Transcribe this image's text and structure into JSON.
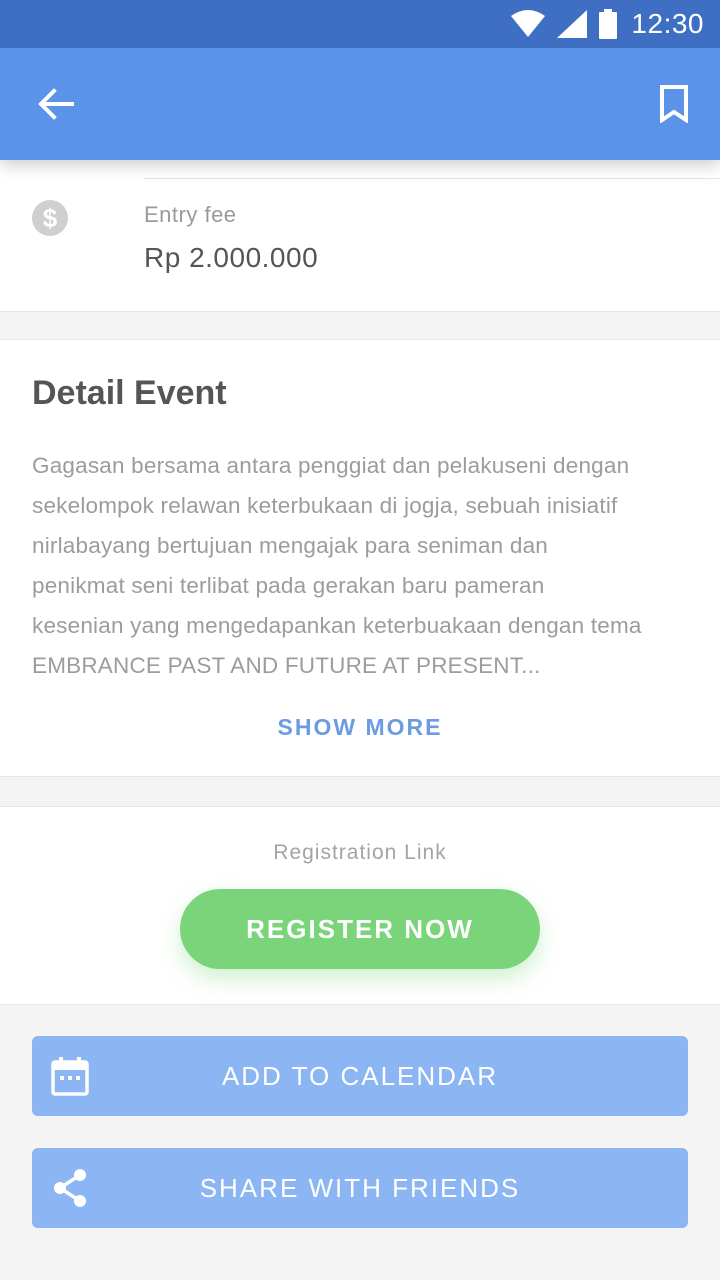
{
  "status_bar": {
    "time": "12:30"
  },
  "app_bar": {
    "back_icon": "arrow-left-icon",
    "bookmark_icon": "bookmark-icon"
  },
  "fee": {
    "icon": "dollar-icon",
    "label": "Entry fee",
    "value": "Rp 2.000.000"
  },
  "detail": {
    "title": "Detail Event",
    "description_lines": [
      "Gagasan bersama antara penggiat dan pelakuseni dengan",
      "sekelompok relawan keterbukaan di jogja, sebuah inisiatif",
      "nirlabayang bertujuan mengajak para seniman dan",
      "penikmat seni terlibat pada gerakan baru pameran",
      "kesenian yang mengedapankan keterbuakaan dengan tema",
      "EMBRANCE PAST AND FUTURE AT PRESENT..."
    ],
    "show_more": "SHOW MORE"
  },
  "registration": {
    "label": "Registration Link",
    "button": "REGISTER NOW"
  },
  "actions": {
    "calendar": {
      "label": "ADD TO CALENDAR",
      "icon": "calendar-icon"
    },
    "share": {
      "label": "SHARE WITH FRIENDS",
      "icon": "share-icon"
    }
  },
  "colors": {
    "status_bar": "#3f6fc2",
    "app_bar": "#5b93e8",
    "register_button": "#79d47a",
    "action_button": "#8cb5f3",
    "link": "#6b9be0"
  }
}
